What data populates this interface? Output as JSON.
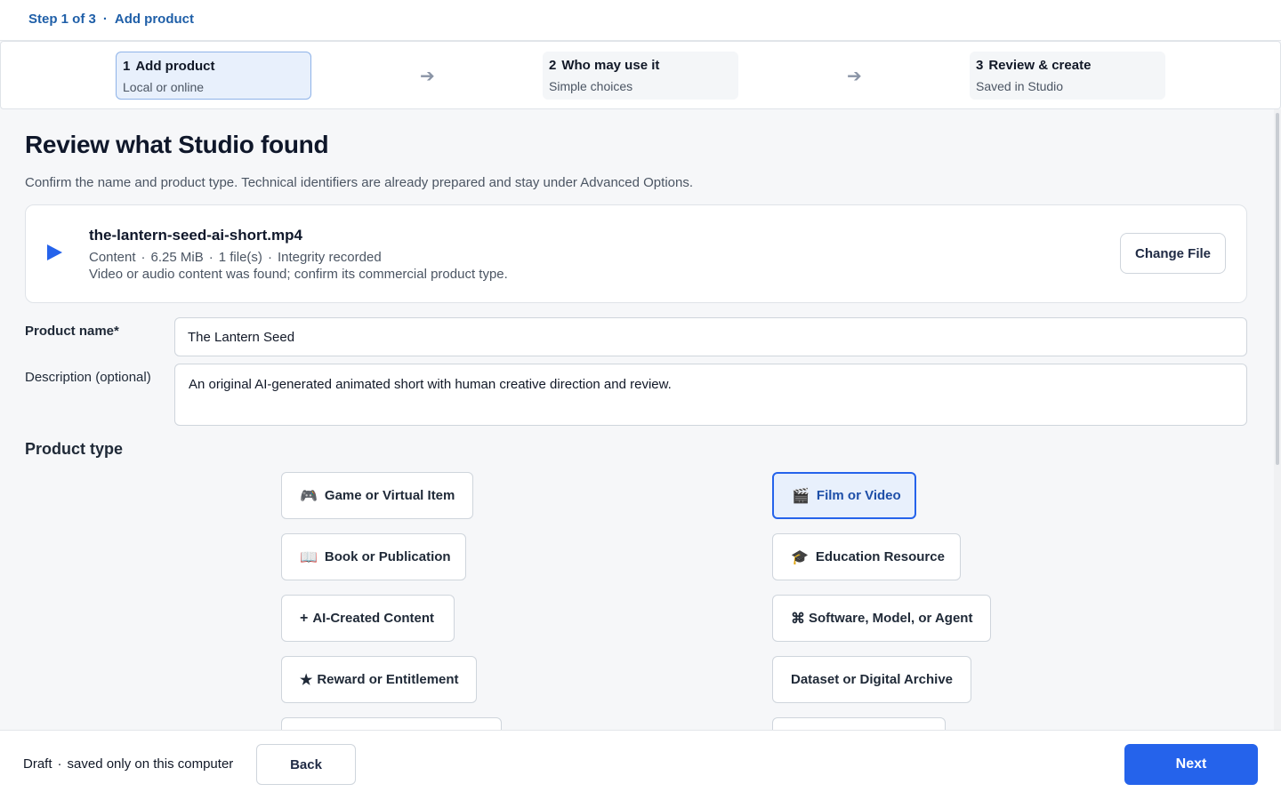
{
  "breadcrumb": {
    "step": "Step 1 of 3",
    "separator": "·",
    "page": "Add product"
  },
  "stepper": {
    "steps": [
      {
        "number": "1",
        "title": "Add product",
        "subtitle": "Local or online",
        "active": true
      },
      {
        "number": "2",
        "title": "Who may use it",
        "subtitle": "Simple choices",
        "active": false
      },
      {
        "number": "3",
        "title": "Review & create",
        "subtitle": "Saved in Studio",
        "active": false
      }
    ],
    "arrow_glyph": "➔"
  },
  "main": {
    "title": "Review what Studio found",
    "subtitle": "Confirm the name and product type. Technical identifiers are already prepared and stay under Advanced Options.",
    "file": {
      "icon": "play-icon",
      "name": "the-lantern-seed-ai-short.mp4",
      "kind": "Content",
      "size": "6.25 MiB",
      "files": "1 file(s)",
      "integrity": "Integrity recorded",
      "separator": "·",
      "note": "Video or audio content was found; confirm its commercial product type.",
      "change_label": "Change File"
    },
    "product_name": {
      "label": "Product name*",
      "value": "The Lantern Seed"
    },
    "description": {
      "label": "Description (optional)",
      "value": "An original AI-generated animated short with human creative direction and review."
    },
    "product_type": {
      "title": "Product type",
      "options": [
        {
          "icon": "🎮",
          "icon_name": "game-controller-icon",
          "label": "Game or Virtual Item",
          "selected": false
        },
        {
          "icon": "🎬",
          "icon_name": "clapperboard-icon",
          "label": "Film or Video",
          "selected": true
        },
        {
          "icon": "📖",
          "icon_name": "open-book-icon",
          "label": "Book or Publication",
          "selected": false
        },
        {
          "icon": "🎓",
          "icon_name": "graduation-cap-icon",
          "label": "Education Resource",
          "selected": false
        },
        {
          "icon": "+",
          "icon_name": "plus-icon",
          "label": "AI-Created Content",
          "selected": false
        },
        {
          "icon": "⌘",
          "icon_name": "command-icon",
          "label": "Software, Model, or Agent",
          "selected": false
        },
        {
          "icon": "★",
          "icon_name": "star-icon",
          "label": "Reward or Entitlement",
          "selected": false
        },
        {
          "icon": "",
          "icon_name": "",
          "label": "Dataset or Digital Archive",
          "selected": false
        }
      ]
    }
  },
  "footer": {
    "draft": "Draft",
    "separator": "·",
    "draft_note": "saved only on this computer",
    "back_label": "Back",
    "next_label": "Next"
  },
  "colors": {
    "accent": "#2563eb",
    "selected_bg": "#e8f0fc",
    "breadcrumb": "#1f5fa8"
  }
}
